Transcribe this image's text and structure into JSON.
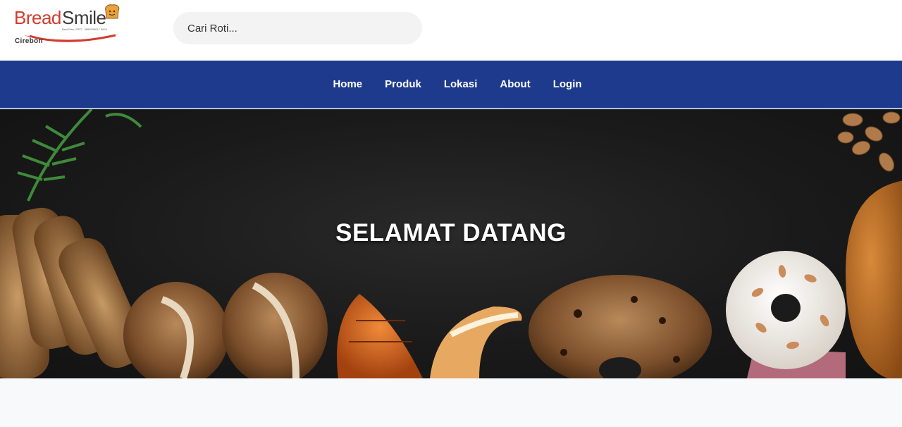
{
  "brand": {
    "name_part1": "Bread",
    "name_part2": "Smile",
    "tagline": "Best Rise, PIRT : 3850208017 9624",
    "city": "Cirebon"
  },
  "search": {
    "placeholder": "Cari Roti..."
  },
  "nav": {
    "items": [
      {
        "label": "Home"
      },
      {
        "label": "Produk"
      },
      {
        "label": "Lokasi"
      },
      {
        "label": "About"
      },
      {
        "label": "Login"
      }
    ]
  },
  "hero": {
    "title": "SELAMAT DATANG"
  },
  "colors": {
    "nav_bg": "#1e3a8c",
    "brand_red": "#d23b2e",
    "hero_bg": "#1a1a1a"
  }
}
